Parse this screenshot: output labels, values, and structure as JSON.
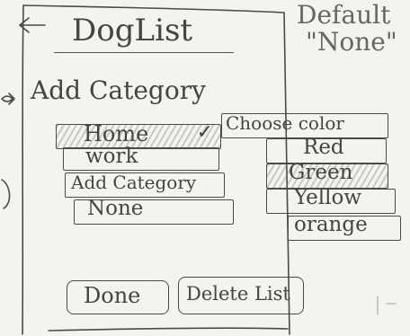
{
  "header": {
    "title": "DogList"
  },
  "note": {
    "line1": "Default",
    "line2": "\"None\""
  },
  "section": {
    "label": "Add Category"
  },
  "categories": [
    "Home",
    "work",
    "Add Category",
    "None"
  ],
  "color_panel": {
    "header": "Choose color",
    "options": [
      "Red",
      "Green",
      "Yellow",
      "orange"
    ]
  },
  "buttons": {
    "done": "Done",
    "delete": "Delete List"
  }
}
